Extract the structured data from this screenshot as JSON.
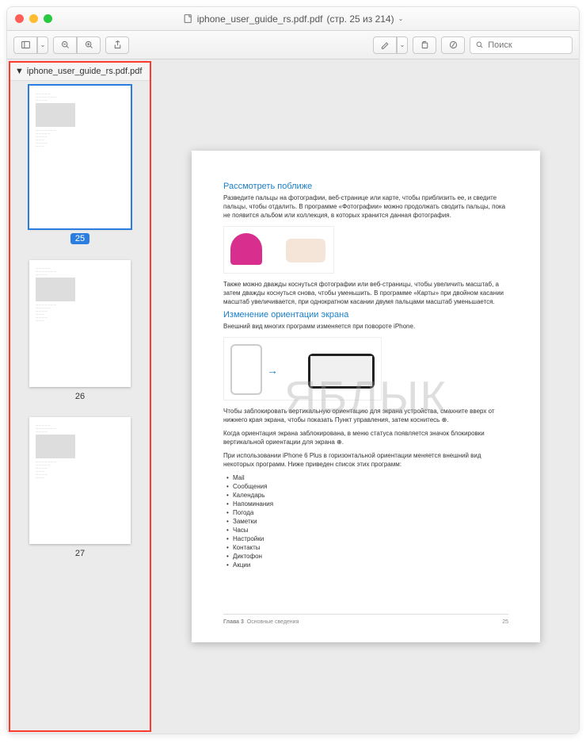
{
  "window": {
    "filename": "iphone_user_guide_rs.pdf.pdf",
    "pageinfo": "(стр. 25 из 214)"
  },
  "toolbar": {
    "searchPlaceholder": "Поиск"
  },
  "sidebar": {
    "header": "iphone_user_guide_rs.pdf.pdf",
    "thumbs": [
      {
        "num": "25",
        "selected": true
      },
      {
        "num": "26",
        "selected": false
      },
      {
        "num": "27",
        "selected": false
      }
    ]
  },
  "page": {
    "h1": "Рассмотреть поближе",
    "p1": "Разведите пальцы на фотографии, веб-странице или карте, чтобы приблизить ее, и сведите пальцы, чтобы отдалить. В программе «Фотографии» можно продолжать сводить пальцы, пока не появится альбом или коллекция, в которых хранится данная фотография.",
    "p2": "Также можно дважды коснуться фотографии или веб-страницы, чтобы увеличить масштаб, а затем дважды коснуться снова, чтобы уменьшить. В программе «Карты» при двойном касании масштаб увеличивается, при однократном касании двумя пальцами масштаб уменьшается.",
    "h2": "Изменение ориентации экрана",
    "p3": "Внешний вид многих программ изменяется при повороте iPhone.",
    "p4": "Чтобы заблокировать вертикальную ориентацию для экрана устройства, смахните вверх от нижнего края экрана, чтобы показать Пункт управления, затем коснитесь ⊕.",
    "p5": "Когда ориентация экрана заблокирована, в меню статуса появляется значок блокировки вертикальной ориентации для экрана ⊕.",
    "p6": "При использовании iPhone 6 Plus в горизонтальной ориентации меняется внешний вид некоторых программ. Ниже приведен список этих программ:",
    "list": [
      "Mail",
      "Сообщения",
      "Календарь",
      "Напоминания",
      "Погода",
      "Заметки",
      "Часы",
      "Настройки",
      "Контакты",
      "Диктофон",
      "Акции"
    ],
    "footerChapter": "Глава 3",
    "footerSection": "Основные сведения",
    "footerPage": "25"
  },
  "watermark": "ЯБЛЫК"
}
